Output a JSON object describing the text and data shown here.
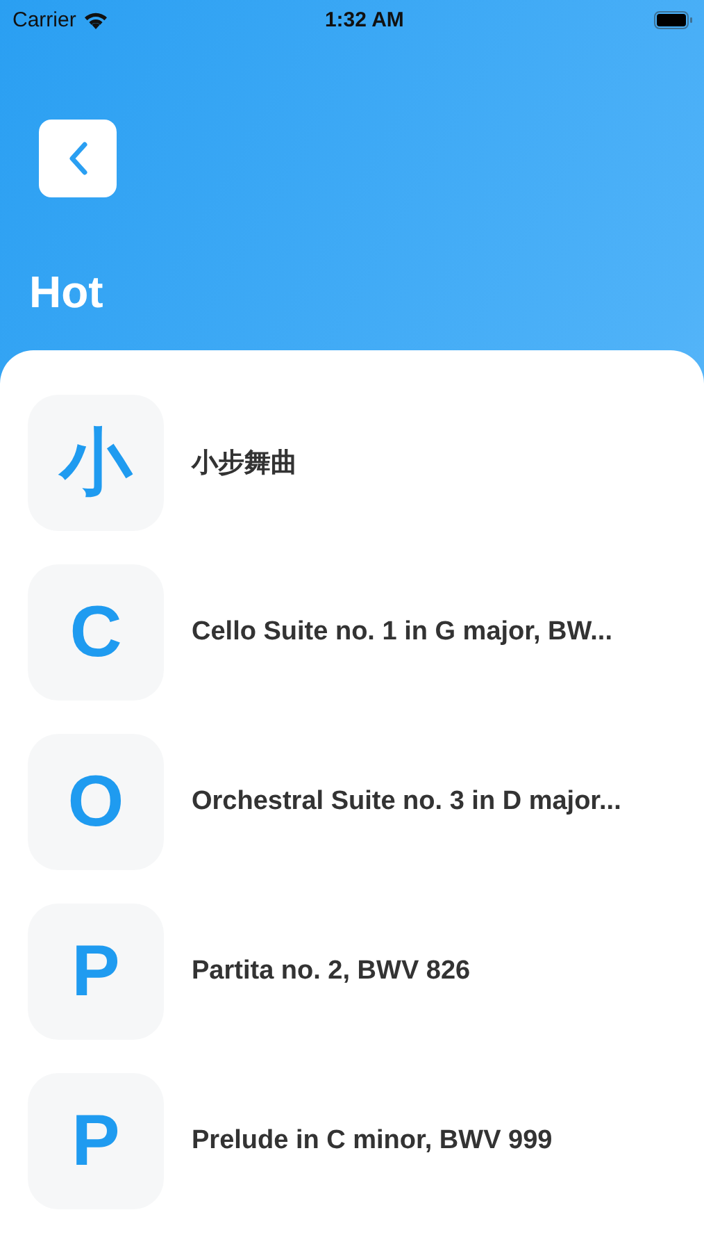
{
  "status_bar": {
    "carrier": "Carrier",
    "time": "1:32 AM"
  },
  "header": {
    "title": "Hot"
  },
  "items": [
    {
      "initial": "小",
      "title": "小步舞曲"
    },
    {
      "initial": "C",
      "title": "Cello Suite no. 1 in G major, BW..."
    },
    {
      "initial": "O",
      "title": "Orchestral Suite no. 3 in D major..."
    },
    {
      "initial": "P",
      "title": "Partita no. 2, BWV 826"
    },
    {
      "initial": "P",
      "title": "Prelude in C minor, BWV 999"
    }
  ]
}
